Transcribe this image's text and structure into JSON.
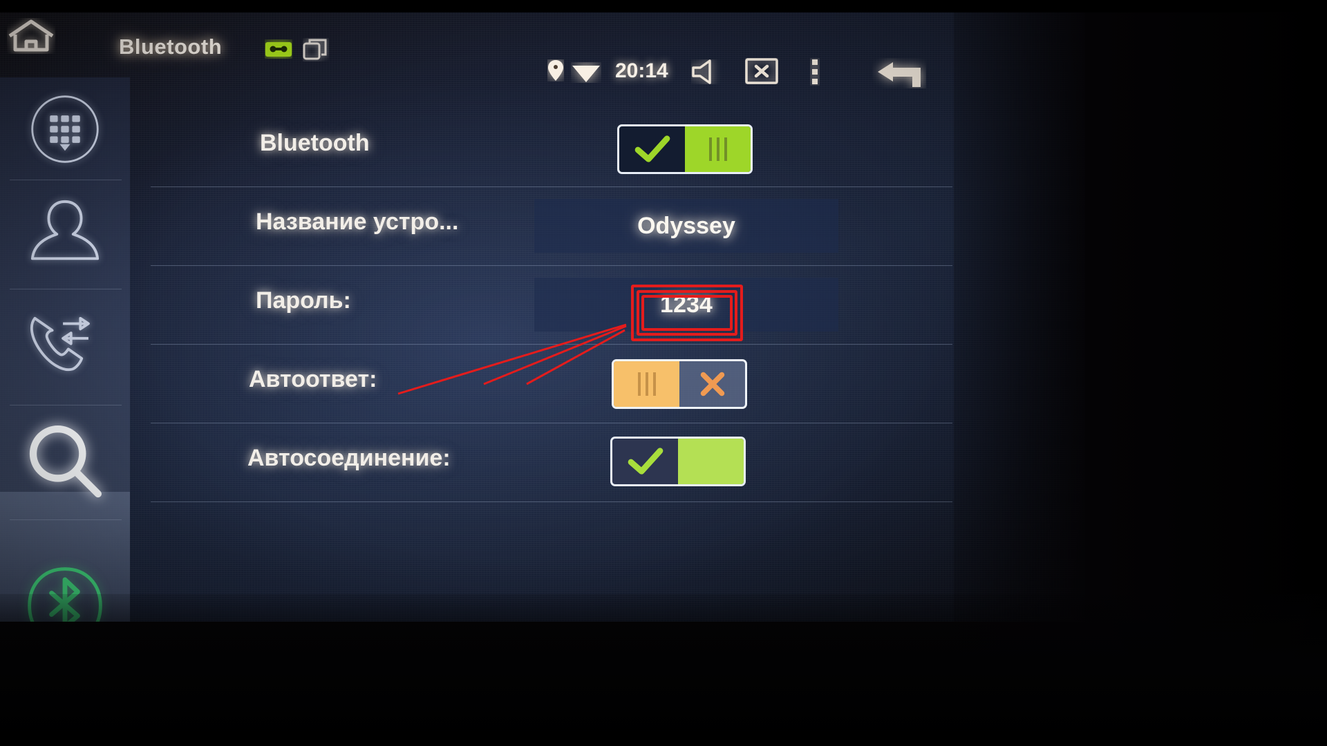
{
  "window": {
    "app_title": "Bluetooth",
    "background_color": "#101826",
    "accent_on_color": "#9ed629",
    "accent_off_color": "#f7c06a",
    "annotation_color": "#e41c1c"
  },
  "topbar": {
    "home_icon": "home-icon",
    "radio_icon": "radio-icon",
    "apps_icon": "apps-icon",
    "status": {
      "gps_icon": "location-pin-icon",
      "wifi_icon": "wifi-icon",
      "time": "20:14",
      "volume_icon": "volume-icon",
      "screen_off_icon": "screen-off-icon",
      "menu_icon": "more-vertical-icon",
      "back_icon": "back-arrow-icon"
    }
  },
  "sidebar": {
    "items": [
      {
        "name": "dialpad",
        "icon": "dialpad-icon",
        "active": false
      },
      {
        "name": "contacts",
        "icon": "contact-person-icon",
        "active": false
      },
      {
        "name": "call-history",
        "icon": "call-transfer-icon",
        "active": false
      },
      {
        "name": "search",
        "icon": "search-icon",
        "active": false
      },
      {
        "name": "bluetooth-settings",
        "icon": "bluetooth-icon",
        "active": true
      }
    ]
  },
  "settings": {
    "rows": [
      {
        "label": "Bluetooth",
        "control": "toggle",
        "state": "on",
        "on_icon": "check-icon",
        "off_icon": "cross-icon"
      },
      {
        "label": "Название устро...",
        "control": "value",
        "value": "Odyssey"
      },
      {
        "label": "Пароль:",
        "control": "value",
        "value": "1234",
        "highlighted": true
      },
      {
        "label": "Автоответ:",
        "control": "toggle",
        "state": "off",
        "on_icon": "check-icon",
        "off_icon": "cross-icon"
      },
      {
        "label": "Автосоединение:",
        "control": "toggle",
        "state": "on",
        "on_icon": "check-icon",
        "off_icon": "cross-icon"
      }
    ]
  },
  "annotation": {
    "target_label": "1234",
    "boxes": 3,
    "pointer_lines": 3
  }
}
